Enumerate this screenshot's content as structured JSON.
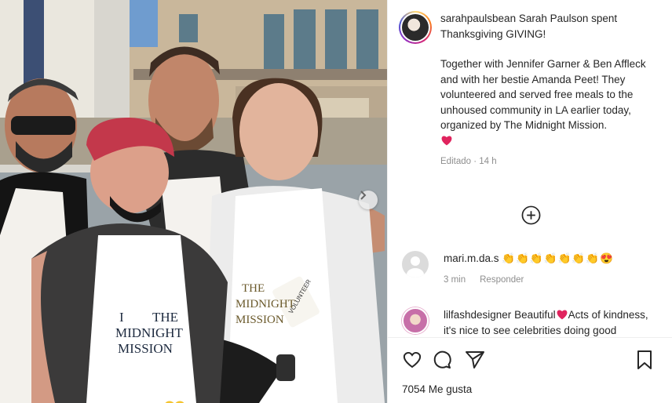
{
  "post": {
    "username": "sarahpaulsbean",
    "caption_line1": "Sarah Paulson spent Thanksgiving GIVING!",
    "caption_para2": "Together with Jennifer Garner & Ben Affleck and with her bestie Amanda Peet! They volunteered and served free meals to the unhoused community in LA earlier today, organized by The Midnight Mission.",
    "edited_label": "Editado",
    "time": "14 h"
  },
  "photo_text": {
    "apron_center_line1": "THE",
    "apron_center_line2": "MIDNIGHT",
    "apron_center_line3": "MISSION",
    "apron_center_i": "I",
    "apron_right_line1": "THE",
    "apron_right_line2": "MIDNIGHT",
    "apron_right_line3": "MISSION",
    "badge": "VOLUNTEER"
  },
  "comments": [
    {
      "username": "mari.m.da.s",
      "text": "👏👏👏👏👏👏👏😍",
      "time": "3 min",
      "reply_label": "Responder"
    },
    {
      "username": "lilfashdesigner",
      "text_before_heart": "Beautiful",
      "text_after_heart": "Acts of kindness, it's nice to see celebrities doing good"
    }
  ],
  "likes_label": "7054 Me gusta",
  "icons": {
    "avatar": "profile-avatar",
    "add": "plus-circle-icon",
    "like": "heart-outline-icon",
    "comment": "comment-bubble-icon",
    "share": "paper-plane-icon",
    "save": "bookmark-icon",
    "next": "chevron-right-icon"
  },
  "colors": {
    "heart_red": "#e0245e",
    "meta_gray": "#8e8e8e",
    "text": "#262626"
  }
}
